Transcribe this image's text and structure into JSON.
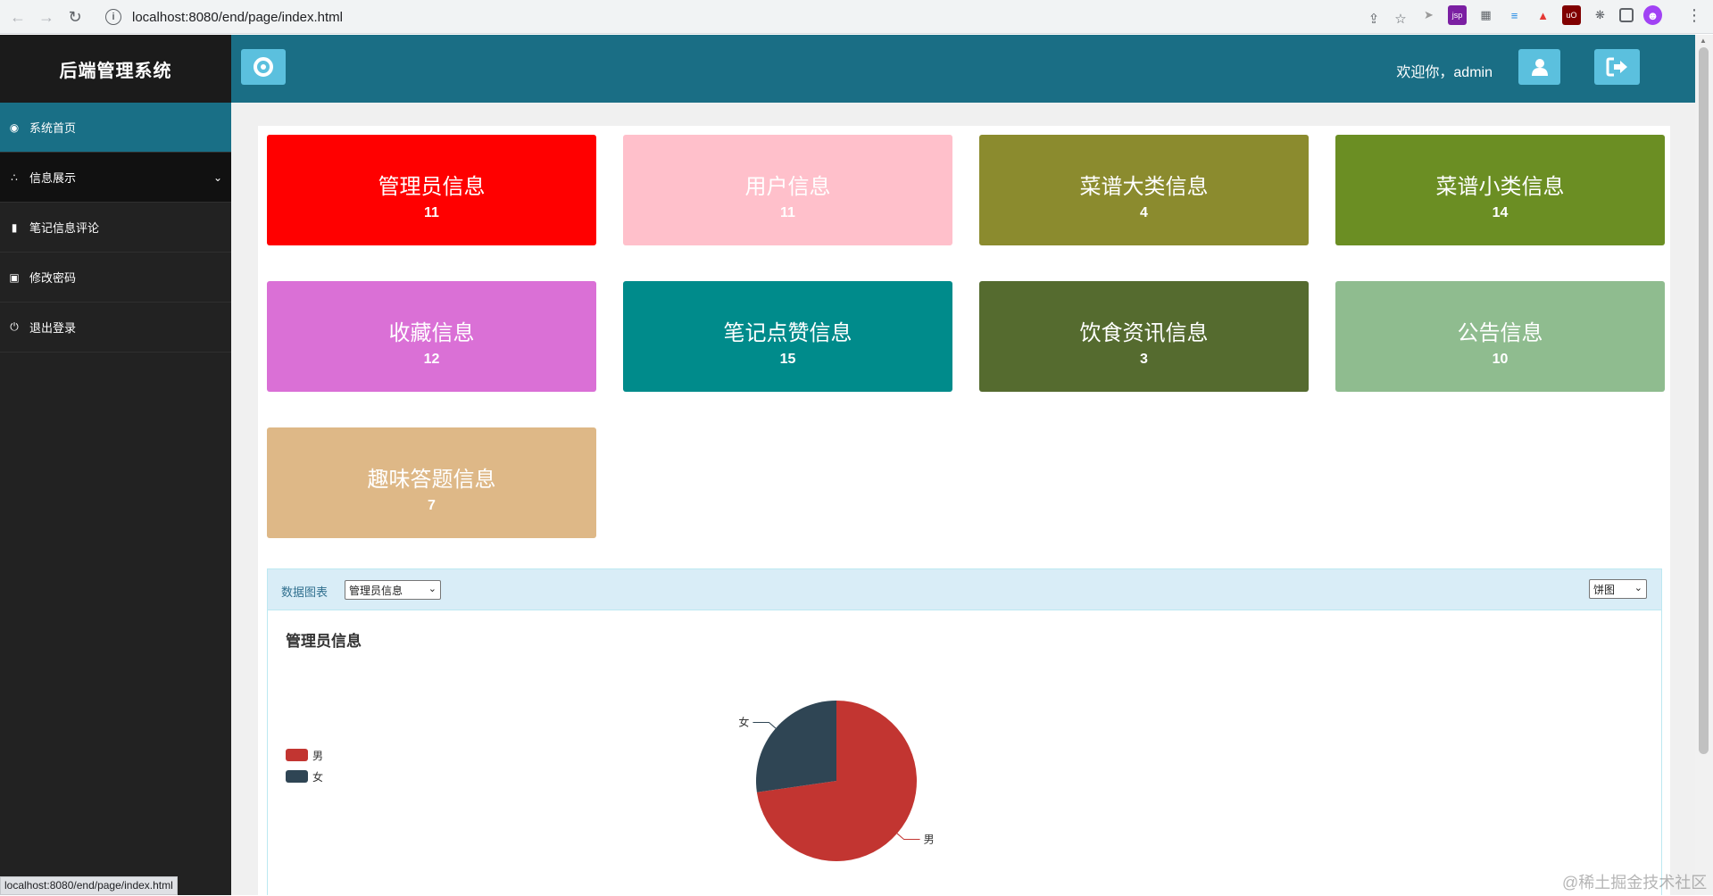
{
  "browser": {
    "url": "localhost:8080/end/page/index.html",
    "status_url": "localhost:8080/end/page/index.html"
  },
  "sidebar": {
    "brand": "后端管理系统",
    "items": [
      {
        "label": "系统首页",
        "icon": "dashboard-icon"
      },
      {
        "label": "信息展示",
        "icon": "cluster-icon"
      },
      {
        "label": "笔记信息评论",
        "icon": "file-icon"
      },
      {
        "label": "修改密码",
        "icon": "lock-icon"
      },
      {
        "label": "退出登录",
        "icon": "power-icon"
      }
    ]
  },
  "topbar": {
    "welcome": "欢迎你，admin"
  },
  "cards": [
    {
      "title": "管理员信息",
      "count": "11",
      "color": "#ff0000"
    },
    {
      "title": "用户信息",
      "count": "11",
      "color": "#ffc0cb"
    },
    {
      "title": "菜谱大类信息",
      "count": "4",
      "color": "#8b8b2e"
    },
    {
      "title": "菜谱小类信息",
      "count": "14",
      "color": "#6b8e23"
    },
    {
      "title": "收藏信息",
      "count": "12",
      "color": "#da70d6"
    },
    {
      "title": "笔记点赞信息",
      "count": "15",
      "color": "#008b8b"
    },
    {
      "title": "饮食资讯信息",
      "count": "3",
      "color": "#556b2f"
    },
    {
      "title": "公告信息",
      "count": "10",
      "color": "#8fbc8f"
    },
    {
      "title": "趣味答题信息",
      "count": "7",
      "color": "#deb887"
    }
  ],
  "chart_panel": {
    "label": "数据图表",
    "data_select": "管理员信息",
    "type_select": "饼图",
    "title": "管理员信息"
  },
  "chart_data": {
    "type": "pie",
    "title": "管理员信息",
    "legend_position": "left",
    "slices": [
      {
        "name": "男",
        "value": 8,
        "color": "#c23531"
      },
      {
        "name": "女",
        "value": 3,
        "color": "#2f4554"
      }
    ]
  },
  "watermark": "@稀土掘金技术社区"
}
